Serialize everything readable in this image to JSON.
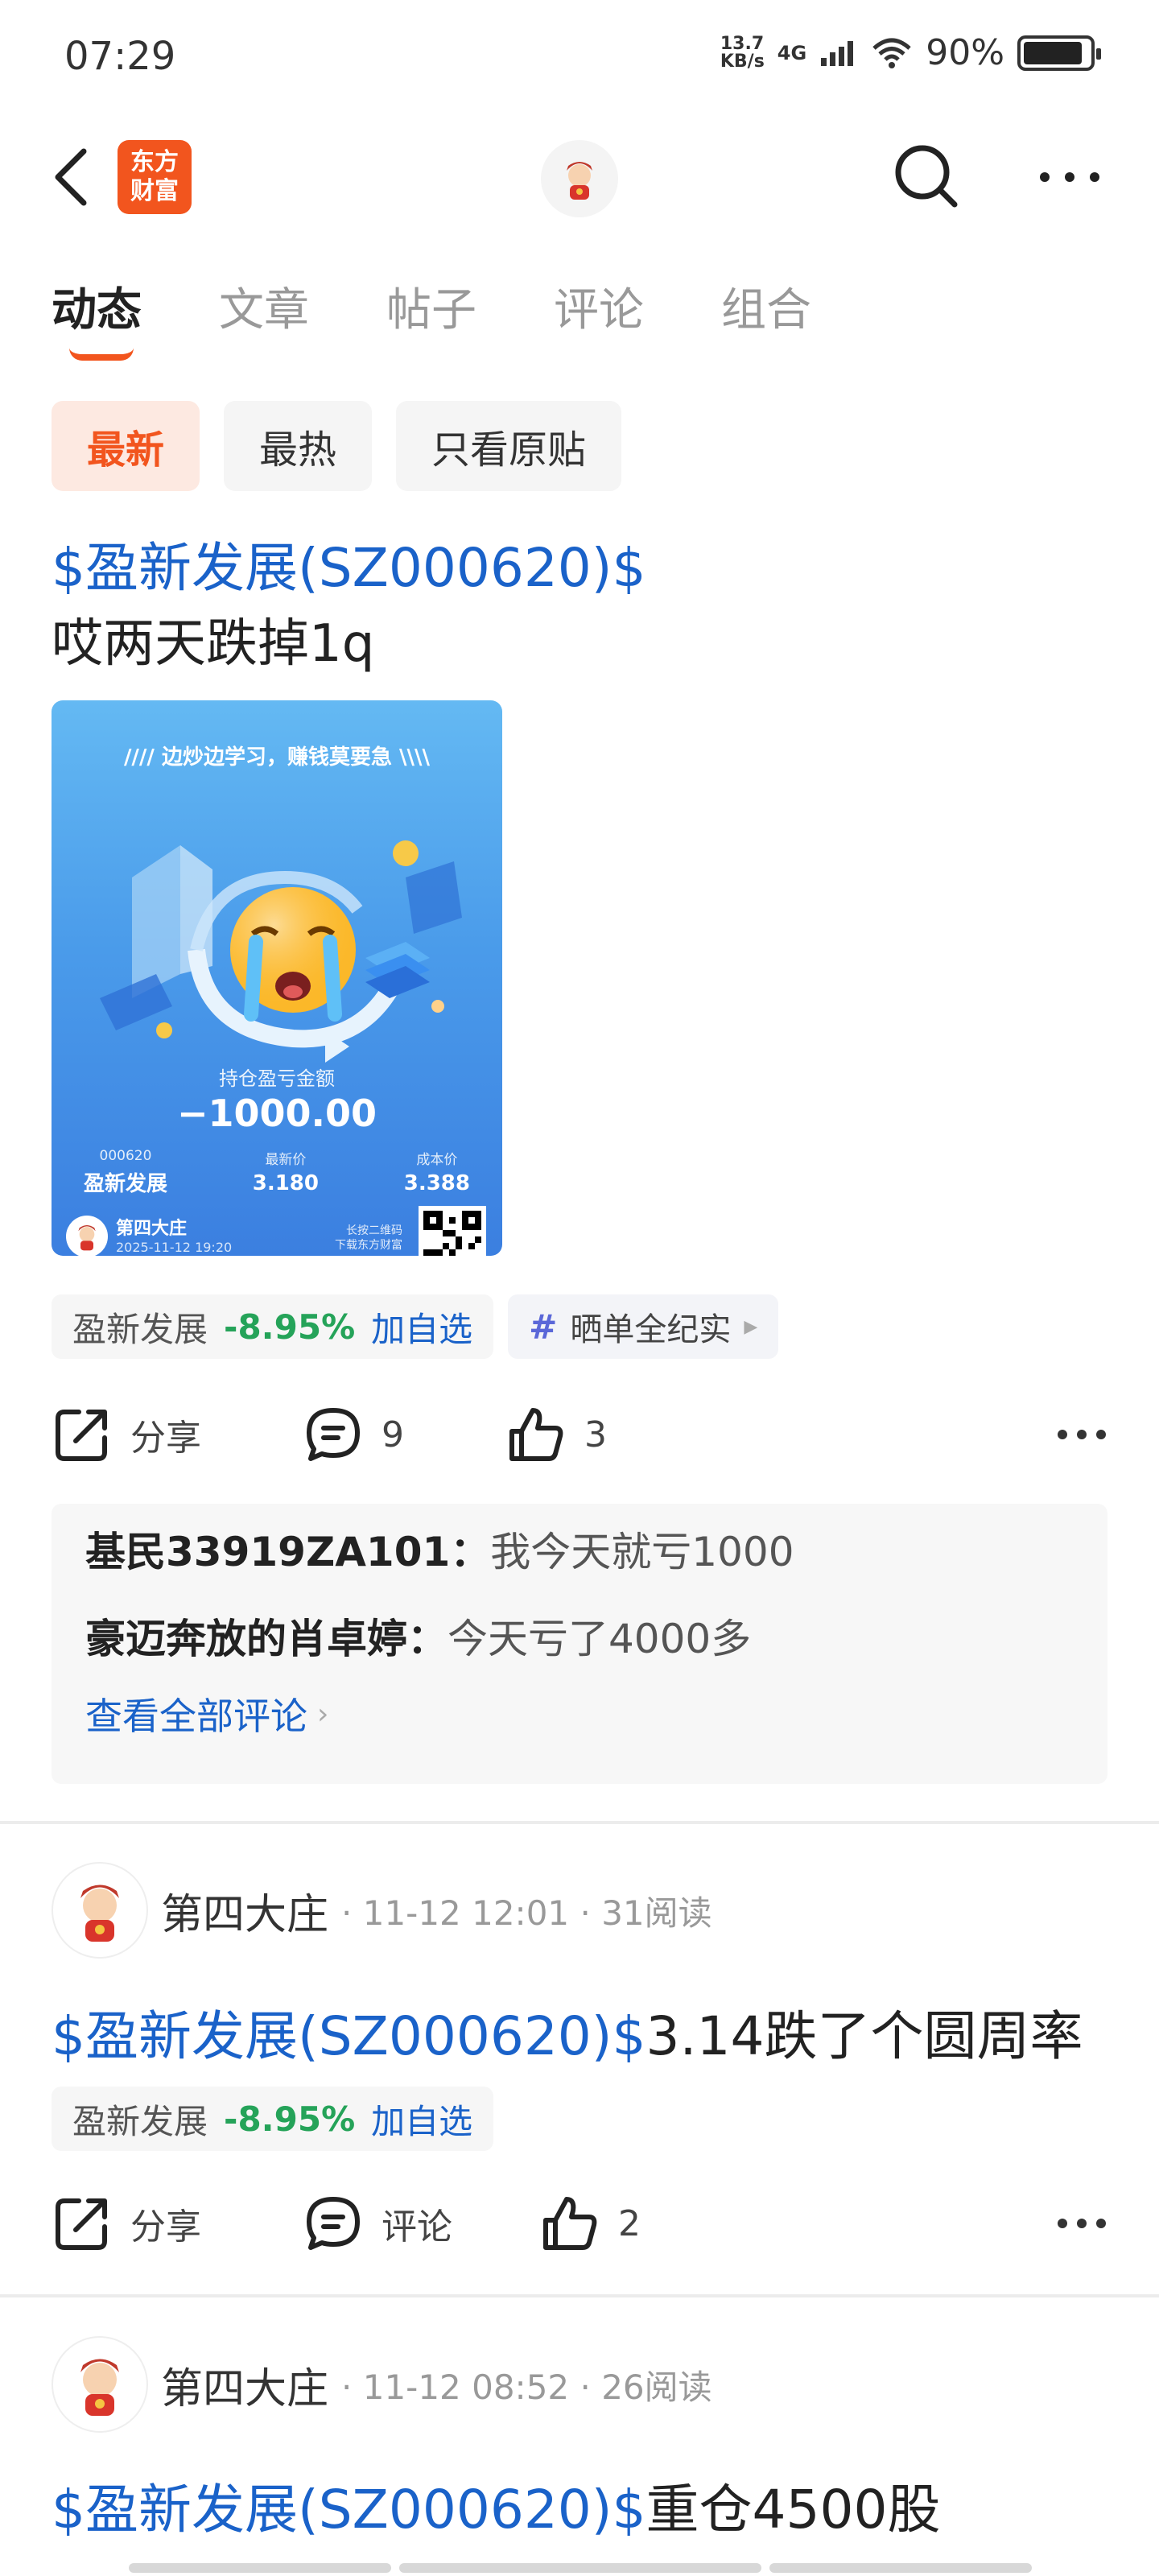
{
  "status": {
    "time": "07:29",
    "speed_value": "13.7",
    "speed_unit": "KB/s",
    "network": "4G",
    "battery": "90%",
    "battery_level": 0.9
  },
  "nav": {
    "logo_line1": "东方",
    "logo_line2": "财富"
  },
  "tabs": [
    "动态",
    "文章",
    "帖子",
    "评论",
    "组合"
  ],
  "filters": [
    "最新",
    "最热",
    "只看原贴"
  ],
  "post1": {
    "stock_link": "$盈新发展(SZ000620)$",
    "text": "哎两天跌掉1q",
    "card": {
      "slogan": "边炒边学习，赚钱莫要急",
      "label": "持仓盈亏金额",
      "amount": "−1000.00",
      "code": "000620",
      "name": "盈新发展",
      "latest_label": "最新价",
      "latest": "3.180",
      "cost_label": "成本价",
      "cost": "3.388",
      "user": "第四大庄",
      "date": "2025-11-12 19:20",
      "qr_line1": "长按二维码",
      "qr_line2": "下载东方财富"
    },
    "stock_tag": {
      "name": "盈新发展",
      "change": "-8.95%",
      "add": "加自选"
    },
    "topic": "晒单全纪实",
    "actions": {
      "share": "分享",
      "comments": "9",
      "likes": "3"
    },
    "comments": [
      {
        "user": "基民33919ZA101：",
        "text": "我今天就亏1000"
      },
      {
        "user": "豪迈奔放的肖卓婷：",
        "text": "今天亏了4000多"
      }
    ],
    "view_all": "查看全部评论"
  },
  "post2": {
    "author": "第四大庄",
    "meta": "· 11-12 12:01 · 31阅读",
    "stock_link": "$盈新发展(SZ000620)$",
    "text": "3.14跌了个圆周率",
    "stock_tag": {
      "name": "盈新发展",
      "change": "-8.95%",
      "add": "加自选"
    },
    "actions": {
      "share": "分享",
      "comments": "评论",
      "likes": "2"
    }
  },
  "post3": {
    "author": "第四大庄",
    "meta": "· 11-12 08:52 · 26阅读",
    "stock_link": "$盈新发展(SZ000620)$",
    "text": "重仓4500股"
  },
  "colors": {
    "accent": "#f2551e",
    "link": "#1a62c9",
    "down_green": "#25a359"
  }
}
